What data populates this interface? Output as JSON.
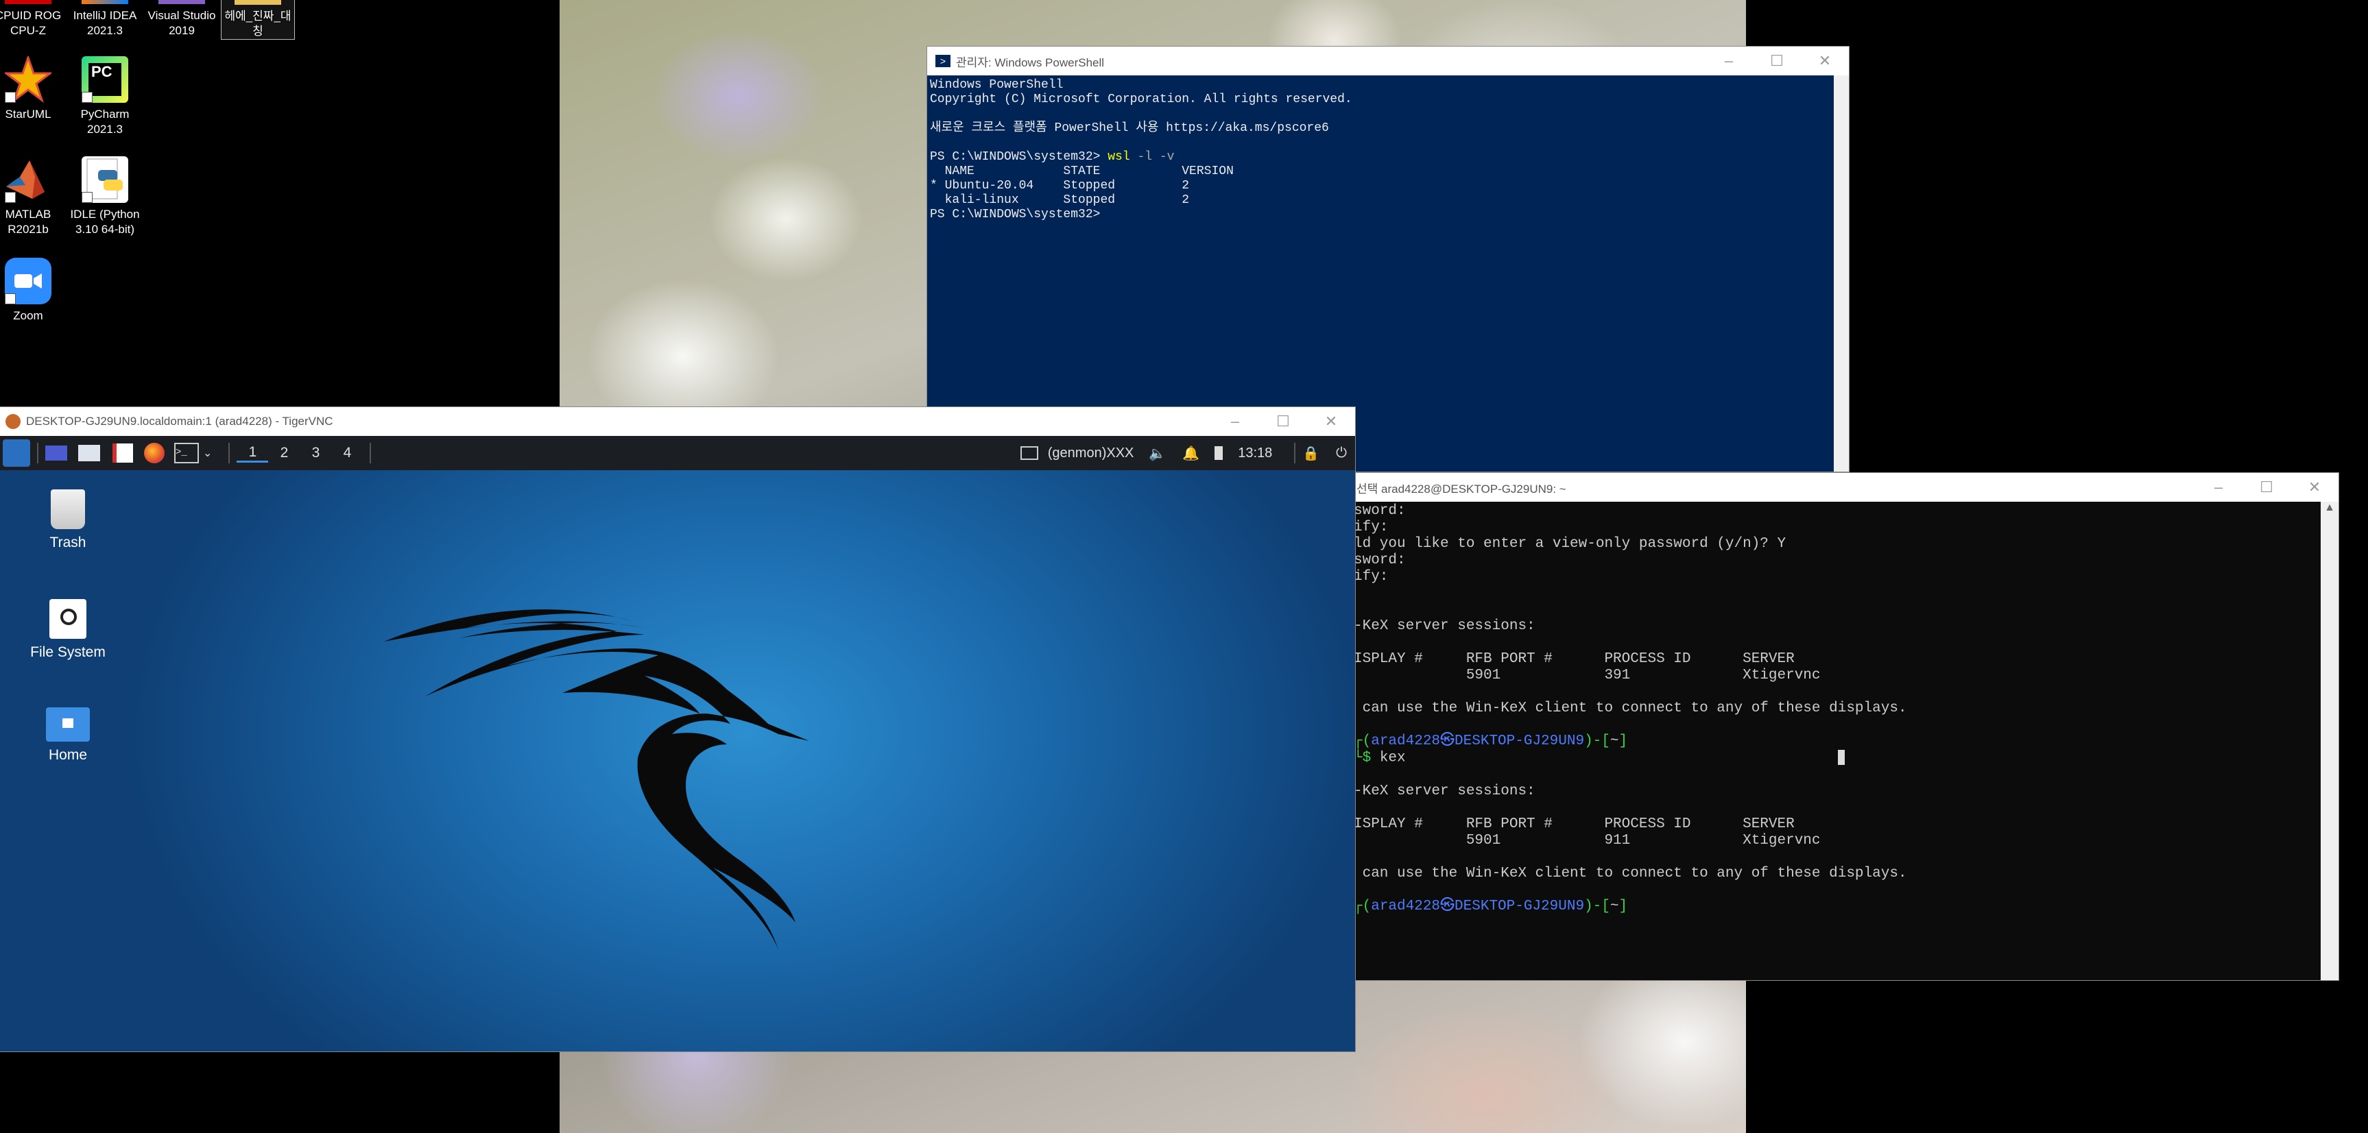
{
  "desktop": {
    "icons": [
      {
        "label": "CPUID ROG CPU-Z"
      },
      {
        "label": "IntelliJ IDEA 2021.3"
      },
      {
        "label": "Visual Studio 2019"
      },
      {
        "label": "헤에_진짜_대칭"
      },
      {
        "label": "StarUML"
      },
      {
        "label": "PyCharm 2021.3"
      },
      {
        "label": "MATLAB R2021b"
      },
      {
        "label": "IDLE (Python 3.10 64-bit)"
      },
      {
        "label": "Zoom"
      }
    ]
  },
  "powershell": {
    "title": "관리자: Windows PowerShell",
    "lines": [
      "Windows PowerShell",
      "Copyright (C) Microsoft Corporation. All rights reserved.",
      "",
      "새로운 크로스 플랫폼 PowerShell 사용 https://aka.ms/pscore6",
      ""
    ],
    "prompt": "PS C:\\WINDOWS\\system32> ",
    "command": "wsl",
    "args": " -l -v",
    "table": [
      "  NAME            STATE           VERSION",
      "* Ubuntu-20.04    Stopped         2",
      "  kali-linux      Stopped         2"
    ],
    "last_prompt": "PS C:\\WINDOWS\\system32>"
  },
  "wsl": {
    "title": "선택 arad4228@DESKTOP-GJ29UN9: ~",
    "block1": [
      "sword:",
      "ify:",
      "ld you like to enter a view-only password (y/n)? Y",
      "sword:",
      "ify:",
      "",
      "",
      "-KeX server sessions:",
      "",
      "ISPLAY #     RFB PORT #      PROCESS ID      SERVER",
      "             5901            391             Xtigervnc",
      "",
      " can use the Win-KeX client to connect to any of these displays.",
      ""
    ],
    "prompt_user": "arad4228㉿DESKTOP-GJ29UN9",
    "prompt_dir": "~",
    "cmd": " kex",
    "block2": [
      "",
      "-KeX server sessions:",
      "",
      "ISPLAY #     RFB PORT #      PROCESS ID      SERVER",
      "             5901            911             Xtigervnc",
      "",
      " can use the Win-KeX client to connect to any of these displays.",
      ""
    ]
  },
  "vnc": {
    "title": "DESKTOP-GJ29UN9.localdomain:1 (arad4228) - TigerVNC",
    "workspaces": [
      "1",
      "2",
      "3",
      "4"
    ],
    "genmon": "(genmon)XXX",
    "clock": "13:18",
    "desktop_icons": [
      {
        "label": "Trash"
      },
      {
        "label": "File System"
      },
      {
        "label": "Home"
      }
    ]
  }
}
